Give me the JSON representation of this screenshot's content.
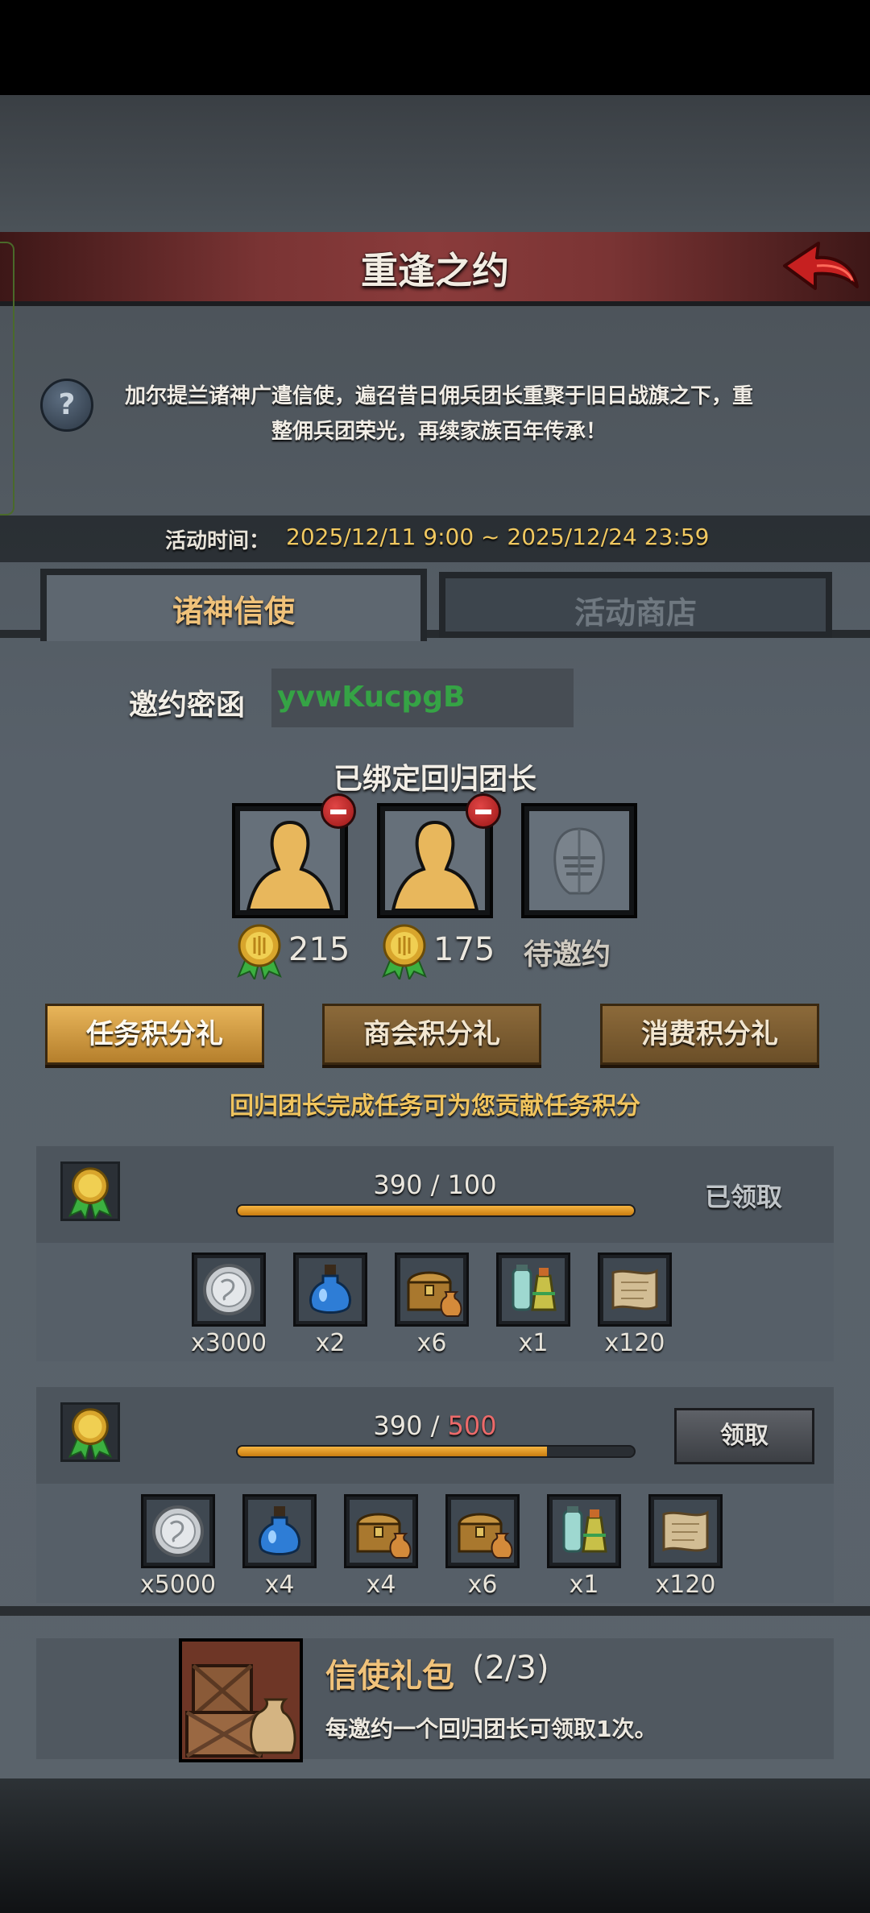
{
  "header": {
    "title": "重逢之约"
  },
  "intro": {
    "description_line1": "加尔提兰诸神广遣信使，遍召昔日佣兵团长重聚于旧日战旗之下，重",
    "description_line2": "整佣兵团荣光，再续家族百年传承！"
  },
  "event_time": {
    "label": "活动时间：",
    "value": "2025/12/11 9:00 ~ 2025/12/24 23:59"
  },
  "tabs": [
    {
      "label": "诸神信使",
      "active": true
    },
    {
      "label": "活动商店",
      "active": false
    }
  ],
  "invite": {
    "label": "邀约密函",
    "code": "yvwKucpgB"
  },
  "bound": {
    "title": "已绑定回归团长",
    "slots": [
      {
        "score": "215",
        "state": "bound"
      },
      {
        "score": "175",
        "state": "bound"
      },
      {
        "label": "待邀约",
        "state": "empty"
      }
    ]
  },
  "categories": [
    {
      "label": "任务积分礼",
      "active": true
    },
    {
      "label": "商会积分礼",
      "active": false
    },
    {
      "label": "消费积分礼",
      "active": false
    }
  ],
  "hint": "回归团长完成任务可为您贡献任务积分",
  "rewards": [
    {
      "current": "390",
      "separator": " / ",
      "target": "100",
      "progress": 1.0,
      "status_label": "已领取",
      "claimable": false,
      "items": [
        {
          "icon": "silver-coin-icon",
          "qty": "x3000"
        },
        {
          "icon": "blue-potion-icon",
          "qty": "x2"
        },
        {
          "icon": "treasure-chest-icon",
          "qty": "x6"
        },
        {
          "icon": "elixir-bottles-icon",
          "qty": "x1"
        },
        {
          "icon": "scroll-icon",
          "qty": "x120"
        }
      ]
    },
    {
      "current": "390",
      "separator": " / ",
      "target": "500",
      "progress": 0.78,
      "status_label": "领取",
      "claimable": true,
      "items": [
        {
          "icon": "silver-coin-icon",
          "qty": "x5000"
        },
        {
          "icon": "blue-potion-icon",
          "qty": "x4"
        },
        {
          "icon": "treasure-chest-icon",
          "qty": "x4"
        },
        {
          "icon": "treasure-chest-icon",
          "qty": "x6"
        },
        {
          "icon": "elixir-bottles-icon",
          "qty": "x1"
        },
        {
          "icon": "scroll-icon",
          "qty": "x120"
        }
      ]
    }
  ],
  "pack": {
    "title": "信使礼包",
    "count": "(2/3)",
    "description": "每邀约一个回归团长可领取1次。"
  },
  "colors": {
    "accent_gold": "#f0c27a",
    "progress_fill": "#f5b440",
    "time_value": "#f0c860",
    "code_green": "#35a345",
    "deficit_red": "#ec6a6a"
  }
}
